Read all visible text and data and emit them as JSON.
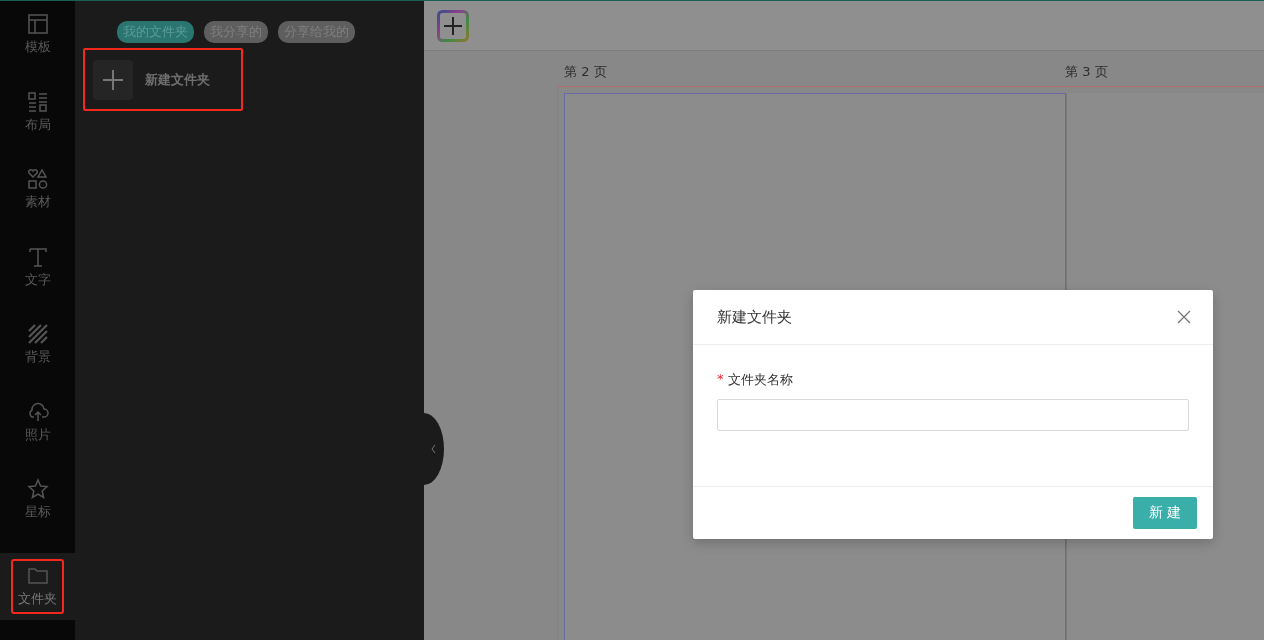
{
  "rail": {
    "items": [
      {
        "label": "模板",
        "kind": "template",
        "selected": false,
        "highlighted": false
      },
      {
        "label": "布局",
        "kind": "layout",
        "selected": false,
        "highlighted": false
      },
      {
        "label": "素材",
        "kind": "shapes",
        "selected": false,
        "highlighted": false
      },
      {
        "label": "文字",
        "kind": "text",
        "selected": false,
        "highlighted": false
      },
      {
        "label": "背景",
        "kind": "stripes",
        "selected": false,
        "highlighted": false
      },
      {
        "label": "照片",
        "kind": "upload",
        "selected": false,
        "highlighted": false
      },
      {
        "label": "星标",
        "kind": "star",
        "selected": false,
        "highlighted": false
      },
      {
        "label": "文件夹",
        "kind": "folder",
        "selected": true,
        "highlighted": true
      }
    ]
  },
  "panel": {
    "tabs": [
      {
        "label": "我的文件夹",
        "selected": true
      },
      {
        "label": "我分享的",
        "selected": false
      },
      {
        "label": "分享给我的",
        "selected": false
      }
    ],
    "new_folder": {
      "label": "新建文件夹",
      "highlighted": true
    }
  },
  "canvas": {
    "pages": [
      {
        "label": "第 2 页",
        "selected": true
      },
      {
        "label": "第 3 页",
        "selected": false
      }
    ]
  },
  "dialog": {
    "title": "新建文件夹",
    "field": {
      "label": "文件夹名称",
      "required_mark": "*"
    },
    "button": "新建"
  }
}
